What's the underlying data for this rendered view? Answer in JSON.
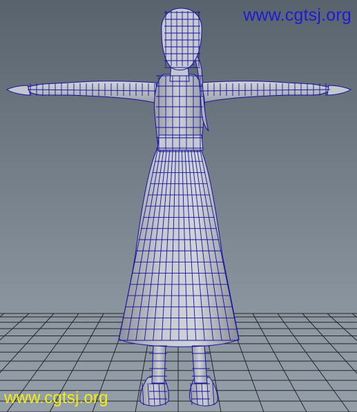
{
  "watermark_top": "www.cgtsj.org",
  "watermark_bottom": "www.cgtsj.org",
  "colors": {
    "background_top": "#58636d",
    "background_bottom": "#949ea8",
    "mesh_fill": "#b9bcc6",
    "wireframe": "#15139a",
    "floor_grid": "#111111",
    "watermark_top": "#1e1bd6",
    "watermark_bottom": "#f2ee10"
  },
  "scene": {
    "model": "female character t-pose wireframe",
    "floor_grid": true
  }
}
